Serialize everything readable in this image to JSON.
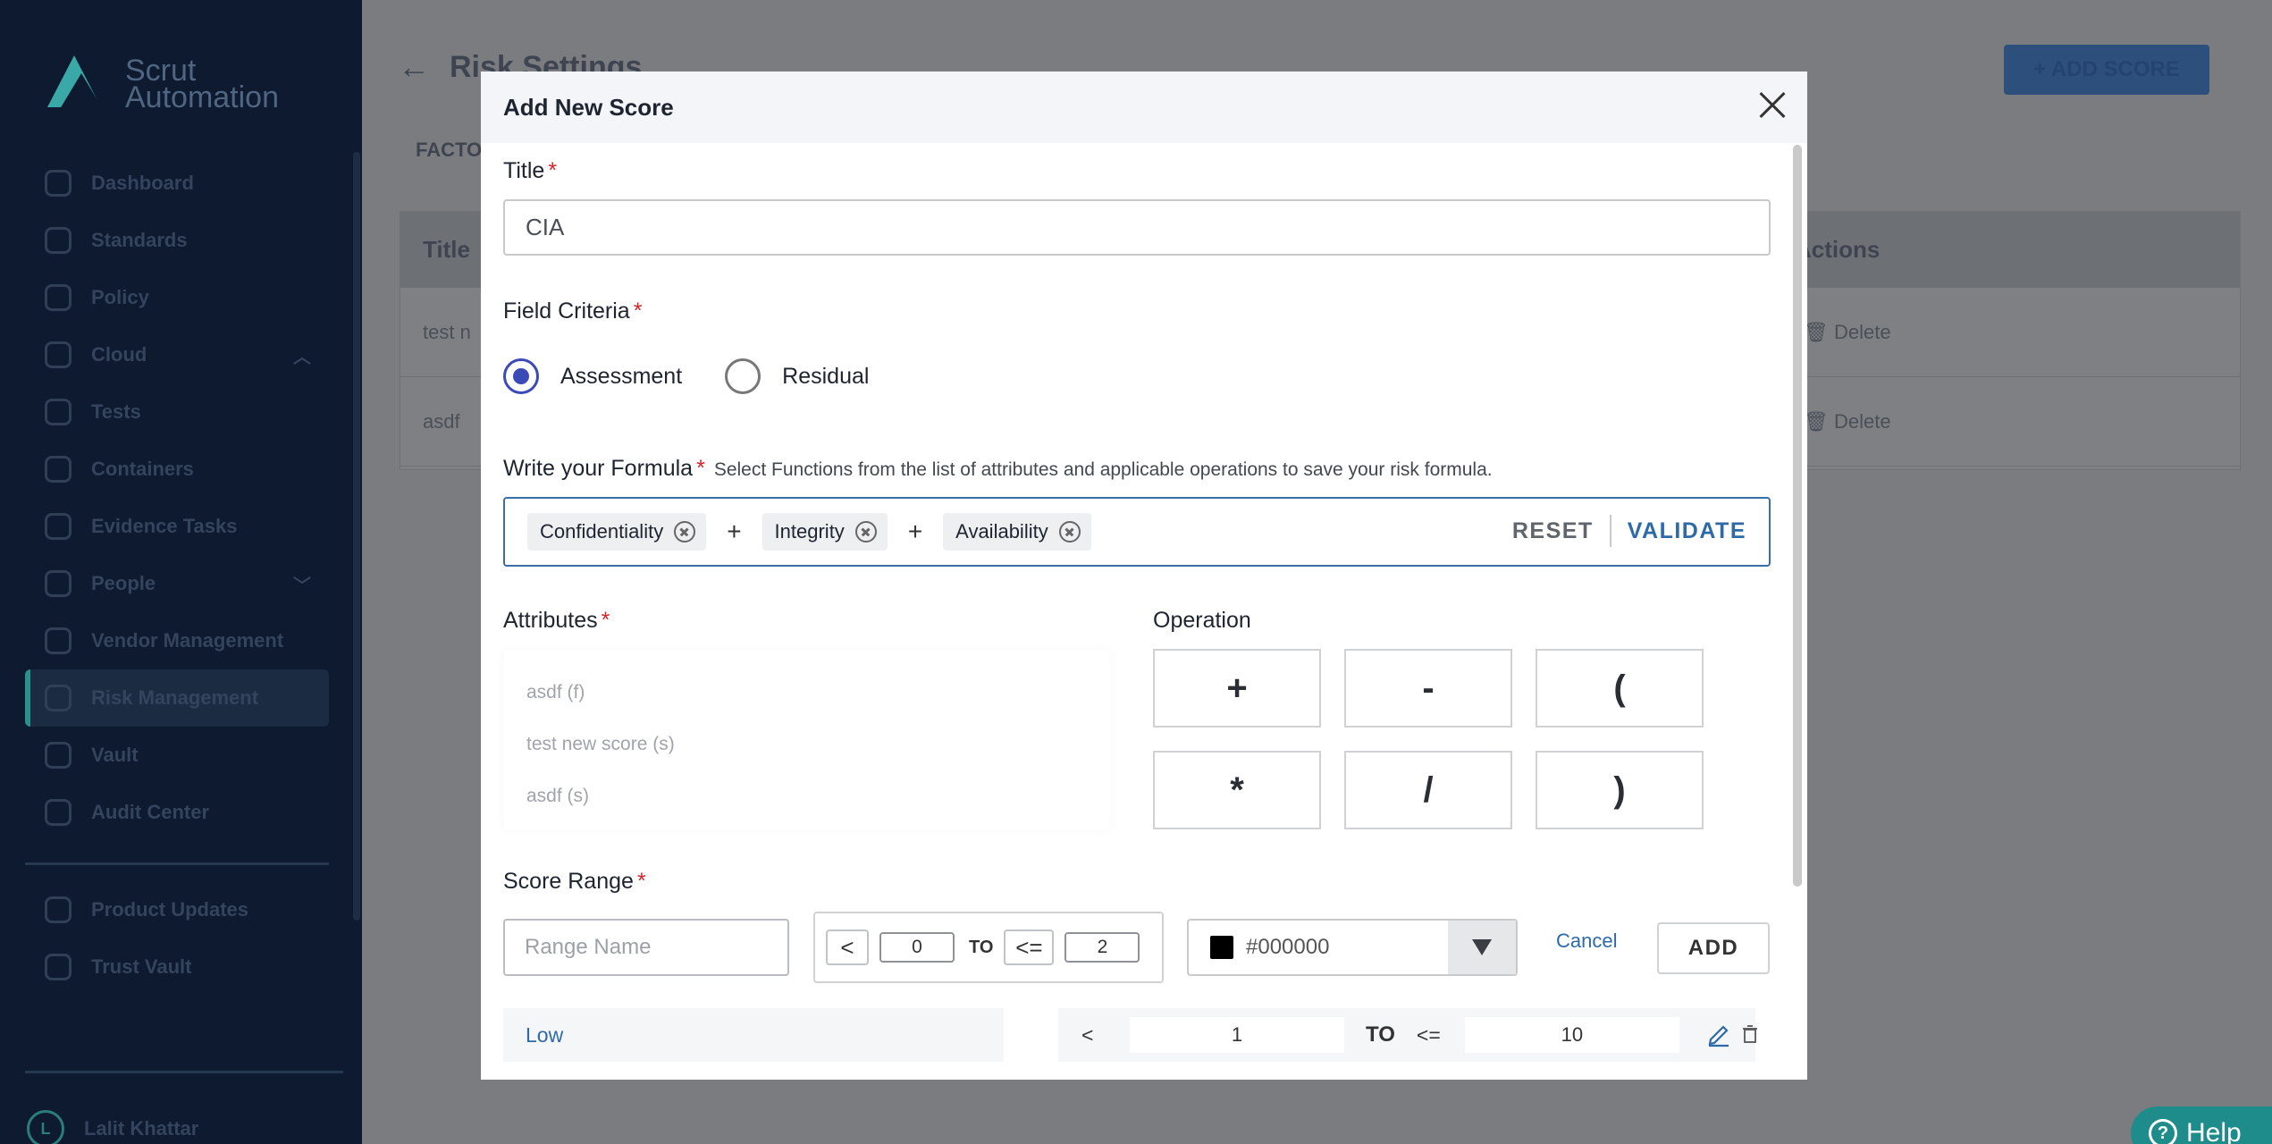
{
  "background": {
    "sidebar": {
      "logo_line1": "Scrut",
      "logo_line2": "Automation",
      "items": [
        {
          "label": "Dashboard"
        },
        {
          "label": "Standards"
        },
        {
          "label": "Policy"
        },
        {
          "label": "Cloud"
        },
        {
          "label": "Tests"
        },
        {
          "label": "Containers"
        },
        {
          "label": "Evidence Tasks"
        },
        {
          "label": "People"
        },
        {
          "label": "Vendor Management"
        },
        {
          "label": "Risk Management"
        },
        {
          "label": "Vault"
        },
        {
          "label": "Audit Center"
        }
      ],
      "bottom_items": [
        {
          "label": "Product Updates"
        },
        {
          "label": "Trust Vault"
        }
      ],
      "user_initial": "L",
      "user_name": "Lalit Khattar"
    },
    "page_title": "Risk Settings",
    "add_score_label": "+ ADD SCORE",
    "tab_label": "FACTO",
    "table": {
      "headers": {
        "title": "Title",
        "actions": "Actions"
      },
      "rows": [
        {
          "title": "test n",
          "action": "Delete"
        },
        {
          "title": "asdf",
          "action": "Delete"
        }
      ]
    },
    "help_label": "Help"
  },
  "modal": {
    "title": "Add New Score",
    "title_field": {
      "label": "Title",
      "value": "CIA"
    },
    "field_criteria": {
      "label": "Field Criteria",
      "options": [
        {
          "label": "Assessment",
          "checked": true
        },
        {
          "label": "Residual",
          "checked": false
        }
      ]
    },
    "formula": {
      "label": "Write your Formula",
      "hint": "Select Functions from the list of attributes and applicable operations to save your risk formula.",
      "tokens": [
        "Confidentiality",
        "+",
        "Integrity",
        "+",
        "Availability"
      ],
      "reset_label": "RESET",
      "validate_label": "VALIDATE"
    },
    "attributes": {
      "label": "Attributes",
      "items": [
        "asdf (f)",
        "test new score (s)",
        "asdf (s)"
      ]
    },
    "operation": {
      "label": "Operation",
      "buttons": [
        "+",
        "-",
        "(",
        "*",
        "/",
        ")"
      ]
    },
    "score_range": {
      "label": "Score Range",
      "name_placeholder": "Range Name",
      "lower_op": "<",
      "lower_value": "0",
      "to_label": "TO",
      "upper_op": "<=",
      "upper_value": "2",
      "color_value": "#000000",
      "cancel_label": "Cancel",
      "add_label": "ADD",
      "rows": [
        {
          "name": "Low",
          "lower_op": "<",
          "lower": "1",
          "to": "TO",
          "upper_op": "<=",
          "upper": "10"
        }
      ]
    }
  },
  "colors": {
    "accent": "#2e6aa8",
    "radio": "#3a4bb8",
    "required": "#d6242b",
    "sidebar": "#0d1a30"
  }
}
